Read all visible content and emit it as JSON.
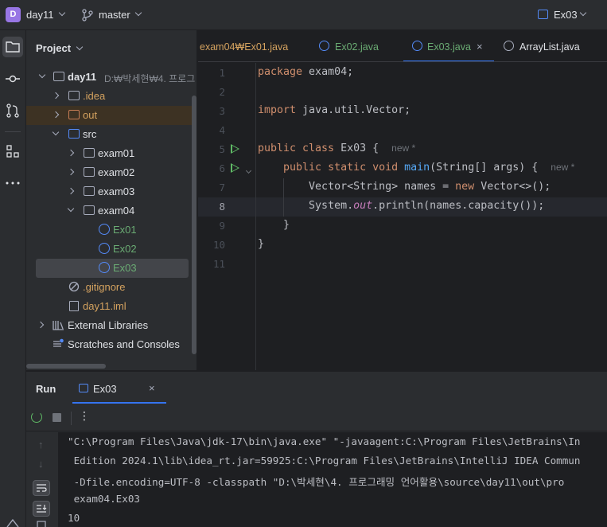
{
  "titlebar": {
    "project_badge": "D",
    "project_name": "day11",
    "branch": "master",
    "run_config": "Ex03"
  },
  "project_panel": {
    "title": "Project",
    "tree": [
      {
        "label": "day11",
        "sub": "D:₩박세현₩4. 프로그"
      },
      {
        "label": ".idea"
      },
      {
        "label": "out"
      },
      {
        "label": "src"
      },
      {
        "label": "exam01"
      },
      {
        "label": "exam02"
      },
      {
        "label": "exam03"
      },
      {
        "label": "exam04"
      },
      {
        "label": "Ex01"
      },
      {
        "label": "Ex02"
      },
      {
        "label": "Ex03"
      },
      {
        "label": ".gitignore"
      },
      {
        "label": "day11.iml"
      },
      {
        "label": "External Libraries"
      },
      {
        "label": "Scratches and Consoles"
      }
    ]
  },
  "editor_tabs": [
    {
      "label": "exam04₩Ex01.java"
    },
    {
      "label": "Ex02.java"
    },
    {
      "label": "Ex03.java",
      "close": "×"
    },
    {
      "label": "ArrayList.java"
    }
  ],
  "editor": {
    "line_numbers": [
      "1",
      "2",
      "3",
      "4",
      "5",
      "6",
      "7",
      "8",
      "9",
      "10",
      "11"
    ],
    "hint_new": "new *",
    "code": {
      "l1_kw": "package",
      "l1_rest": " exam04;",
      "l3_kw": "import",
      "l3_rest": " java.util.Vector;",
      "l5_kw": "public class",
      "l5_rest": " Ex03 {  ",
      "l6_kw": "public static void",
      "l6_fn": " main",
      "l6_rest": "(String[] args) {  ",
      "l7_a": "Vector<String> names = ",
      "l7_kw": "new",
      "l7_b": " Vector<>();",
      "l8_a": "System.",
      "l8_st": "out",
      "l8_b": ".println(names.capacity());",
      "l9": "}",
      "l10": "}"
    }
  },
  "run_panel": {
    "title": "Run",
    "tab_label": "Ex03",
    "tab_close": "×",
    "more": "⋮",
    "console_lines": [
      "\"C:\\Program Files\\Java\\jdk-17\\bin\\java.exe\" \"-javaagent:C:\\Program Files\\JetBrains\\In",
      " Edition 2024.1\\lib\\idea_rt.jar=59925:C:\\Program Files\\JetBrains\\IntelliJ IDEA Commun",
      " -Dfile.encoding=UTF-8 -classpath \"D:\\박세현\\4. 프로그래밍 언어활용\\source\\day11\\out\\pro",
      " exam04.Ex03",
      "10"
    ]
  },
  "colors": {
    "accent": "#3574f0",
    "keyword": "#cf8e6d",
    "function": "#56a8f5",
    "static_field": "#c77dbb",
    "run_green": "#5fb865",
    "class_blue": "#548af7",
    "excluded_orange": "#c77d55"
  }
}
